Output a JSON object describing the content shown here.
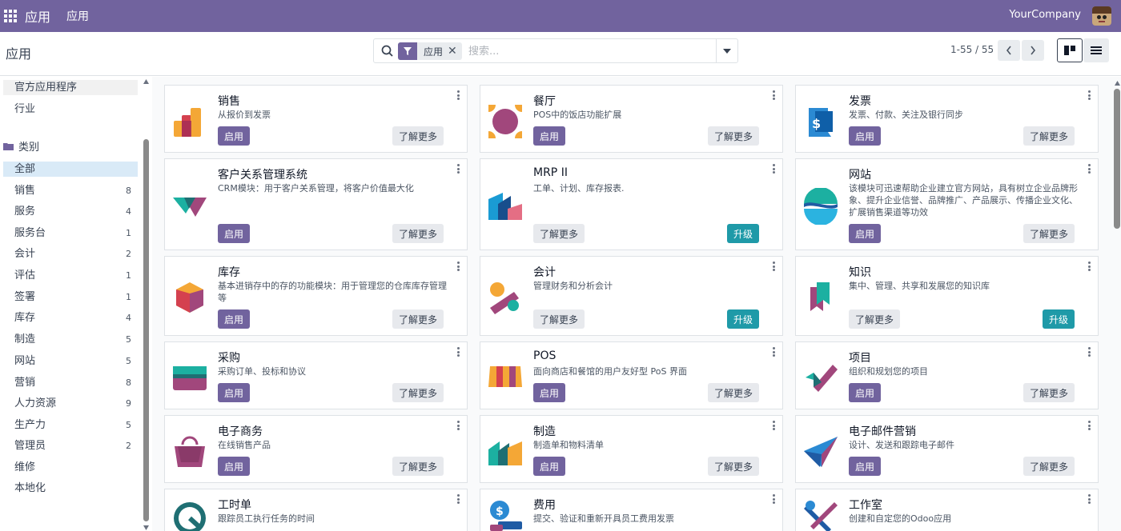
{
  "navbar": {
    "brand": "应用",
    "menu": "应用",
    "company": "YourCompany"
  },
  "control": {
    "breadcrumb": "应用",
    "facet_label": "应用",
    "facet_remove": "✕",
    "search_placeholder": "搜索...",
    "pager": "1-55 / 55"
  },
  "sidebar": {
    "top_items": [
      {
        "label": "官方应用程序"
      },
      {
        "label": "行业"
      }
    ],
    "category_heading": "类别",
    "categories": [
      {
        "label": "全部",
        "count": ""
      },
      {
        "label": "销售",
        "count": "8"
      },
      {
        "label": "服务",
        "count": "4"
      },
      {
        "label": "服务台",
        "count": "1"
      },
      {
        "label": "会计",
        "count": "2"
      },
      {
        "label": "评估",
        "count": "1"
      },
      {
        "label": "签署",
        "count": "1"
      },
      {
        "label": "库存",
        "count": "4"
      },
      {
        "label": "制造",
        "count": "5"
      },
      {
        "label": "网站",
        "count": "5"
      },
      {
        "label": "营销",
        "count": "8"
      },
      {
        "label": "人力资源",
        "count": "9"
      },
      {
        "label": "生产力",
        "count": "5"
      },
      {
        "label": "管理员",
        "count": "2"
      },
      {
        "label": "维修",
        "count": ""
      },
      {
        "label": "本地化",
        "count": ""
      }
    ]
  },
  "buttons": {
    "activate": "启用",
    "learn_more": "了解更多",
    "upgrade": "升级"
  },
  "apps": [
    {
      "name": "销售",
      "summary": "从报价到发票",
      "icon": "sales-icon",
      "mode": "activate"
    },
    {
      "name": "餐厅",
      "summary": "POS中的饭店功能扩展",
      "icon": "restaurant-icon",
      "mode": "activate"
    },
    {
      "name": "发票",
      "summary": "发票、付款、关注及银行同步",
      "icon": "invoicing-icon",
      "mode": "activate"
    },
    {
      "name": "客户关系管理系统",
      "summary": "CRM模块：用于客户关系管理，将客户价值最大化",
      "icon": "crm-icon",
      "mode": "activate"
    },
    {
      "name": "MRP II",
      "summary": "工单、计划、库存报表.",
      "icon": "mrp-icon",
      "mode": "upgrade"
    },
    {
      "name": "网站",
      "summary": "该模块可迅速帮助企业建立官方网站，具有树立企业品牌形象、提升企业信誉、品牌推广、产品展示、传播企业文化、扩展销售渠道等功效",
      "icon": "website-icon",
      "mode": "activate"
    },
    {
      "name": "库存",
      "summary": "基本进销存中的存的功能模块：用于管理您的仓库库存管理等",
      "icon": "inventory-icon",
      "mode": "activate"
    },
    {
      "name": "会计",
      "summary": "管理财务和分析会计",
      "icon": "accounting-icon",
      "mode": "upgrade"
    },
    {
      "name": "知识",
      "summary": "集中、管理、共享和发展您的知识库",
      "icon": "knowledge-icon",
      "mode": "upgrade"
    },
    {
      "name": "采购",
      "summary": "采购订单、投标和协议",
      "icon": "purchase-icon",
      "mode": "activate"
    },
    {
      "name": "POS",
      "summary": "面向商店和餐馆的用户友好型 PoS 界面",
      "icon": "pos-icon",
      "mode": "activate"
    },
    {
      "name": "项目",
      "summary": "组织和规划您的项目",
      "icon": "project-icon",
      "mode": "activate"
    },
    {
      "name": "电子商务",
      "summary": "在线销售产品",
      "icon": "ecommerce-icon",
      "mode": "activate"
    },
    {
      "name": "制造",
      "summary": "制造单和物料清单",
      "icon": "manufacturing-icon",
      "mode": "activate"
    },
    {
      "name": "电子邮件营销",
      "summary": "设计、发送和跟踪电子邮件",
      "icon": "email-marketing-icon",
      "mode": "activate"
    },
    {
      "name": "工时单",
      "summary": "跟踪员工执行任务的时间",
      "icon": "timesheets-icon",
      "mode": "partial"
    },
    {
      "name": "费用",
      "summary": "提交、验证和重新开具员工费用发票",
      "icon": "expenses-icon",
      "mode": "partial"
    },
    {
      "name": "工作室",
      "summary": "创建和自定您的Odoo应用",
      "icon": "studio-icon",
      "mode": "partial"
    }
  ],
  "colors": {
    "brand": "#71639e",
    "upgrade": "#1f9aa8"
  }
}
